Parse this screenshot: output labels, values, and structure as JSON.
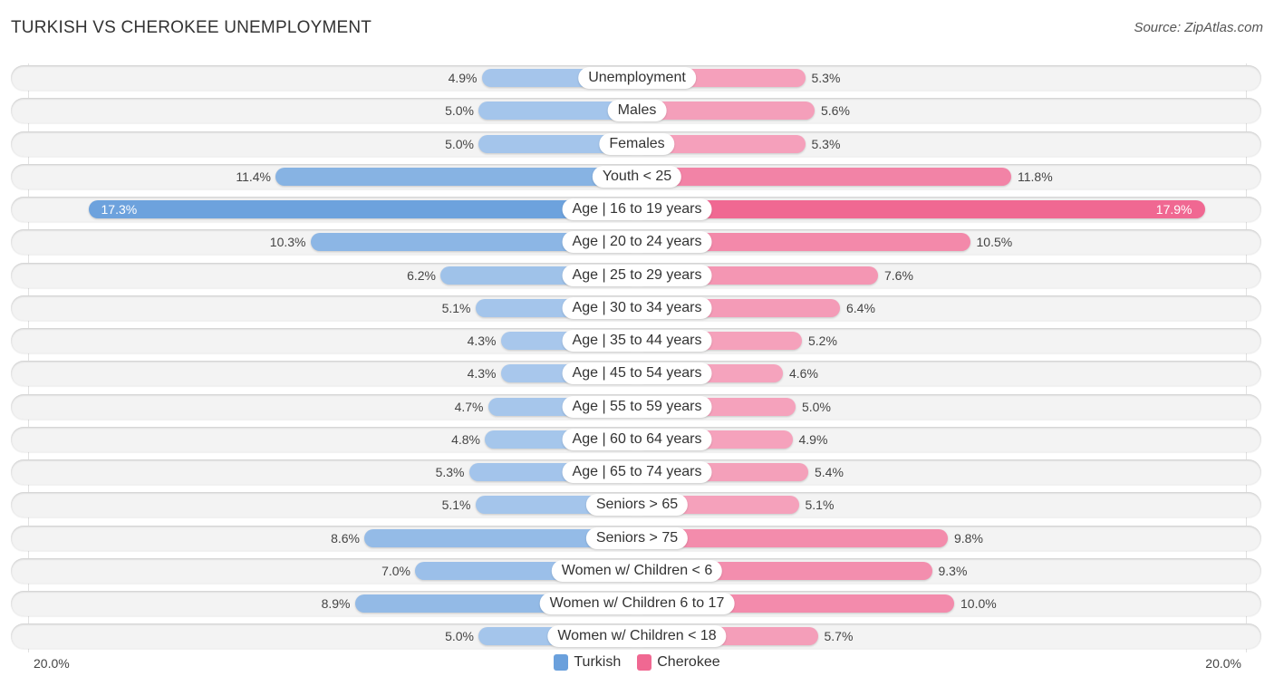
{
  "header": {
    "title": "TURKISH VS CHEROKEE UNEMPLOYMENT",
    "source": "Source: ZipAtlas.com"
  },
  "colors": {
    "turkish": "#6aa0dc",
    "turkish_light": "#a9c8ec",
    "cherokee": "#f06892",
    "cherokee_light": "#f5a6bf"
  },
  "chart_data": {
    "type": "bar",
    "orientation": "horizontal-diverging",
    "title": "TURKISH VS CHEROKEE UNEMPLOYMENT",
    "xlabel": "",
    "ylabel": "",
    "xlim": [
      -20.0,
      20.0
    ],
    "axis_labels": {
      "left": "20.0%",
      "right": "20.0%"
    },
    "legend": {
      "position": "bottom-center",
      "entries": [
        "Turkish",
        "Cherokee"
      ]
    },
    "categories": [
      "Unemployment",
      "Males",
      "Females",
      "Youth < 25",
      "Age | 16 to 19 years",
      "Age | 20 to 24 years",
      "Age | 25 to 29 years",
      "Age | 30 to 34 years",
      "Age | 35 to 44 years",
      "Age | 45 to 54 years",
      "Age | 55 to 59 years",
      "Age | 60 to 64 years",
      "Age | 65 to 74 years",
      "Seniors > 65",
      "Seniors > 75",
      "Women w/ Children < 6",
      "Women w/ Children 6 to 17",
      "Women w/ Children < 18"
    ],
    "series": [
      {
        "name": "Turkish",
        "side": "left",
        "values": [
          4.9,
          5.0,
          5.0,
          11.4,
          17.3,
          10.3,
          6.2,
          5.1,
          4.3,
          4.3,
          4.7,
          4.8,
          5.3,
          5.1,
          8.6,
          7.0,
          8.9,
          5.0
        ],
        "labels": [
          "4.9%",
          "5.0%",
          "5.0%",
          "11.4%",
          "17.3%",
          "10.3%",
          "6.2%",
          "5.1%",
          "4.3%",
          "4.3%",
          "4.7%",
          "4.8%",
          "5.3%",
          "5.1%",
          "8.6%",
          "7.0%",
          "8.9%",
          "5.0%"
        ]
      },
      {
        "name": "Cherokee",
        "side": "right",
        "values": [
          5.3,
          5.6,
          5.3,
          11.8,
          17.9,
          10.5,
          7.6,
          6.4,
          5.2,
          4.6,
          5.0,
          4.9,
          5.4,
          5.1,
          9.8,
          9.3,
          10.0,
          5.7
        ],
        "labels": [
          "5.3%",
          "5.6%",
          "5.3%",
          "11.8%",
          "17.9%",
          "10.5%",
          "7.6%",
          "6.4%",
          "5.2%",
          "4.6%",
          "5.0%",
          "4.9%",
          "5.4%",
          "5.1%",
          "9.8%",
          "9.3%",
          "10.0%",
          "5.7%"
        ]
      }
    ]
  }
}
